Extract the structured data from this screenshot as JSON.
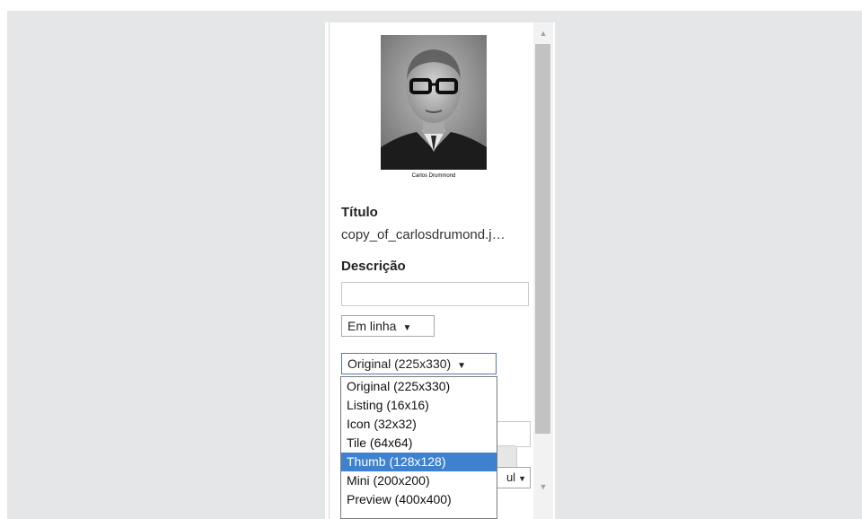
{
  "image": {
    "caption": "Carlos Drummond"
  },
  "fields": {
    "title_label": "Título",
    "title_value": "copy_of_carlosdrumond.j…",
    "description_label": "Descrição",
    "description_value": ""
  },
  "alignment_select": {
    "selected": "Em linha"
  },
  "size_select": {
    "selected": "Original (225x330)",
    "options": [
      "Original (225x330)",
      "Listing (16x16)",
      "Icon (32x32)",
      "Tile (64x64)",
      "Thumb (128x128)",
      "Mini (200x200)",
      "Preview (400x400)"
    ],
    "highlighted_index": 4
  },
  "partial_select": {
    "visible_text": "ul"
  },
  "icons": {
    "dropdown_arrow": "triangle-down",
    "scroll_up": "triangle-up",
    "scroll_down": "triangle-down"
  }
}
